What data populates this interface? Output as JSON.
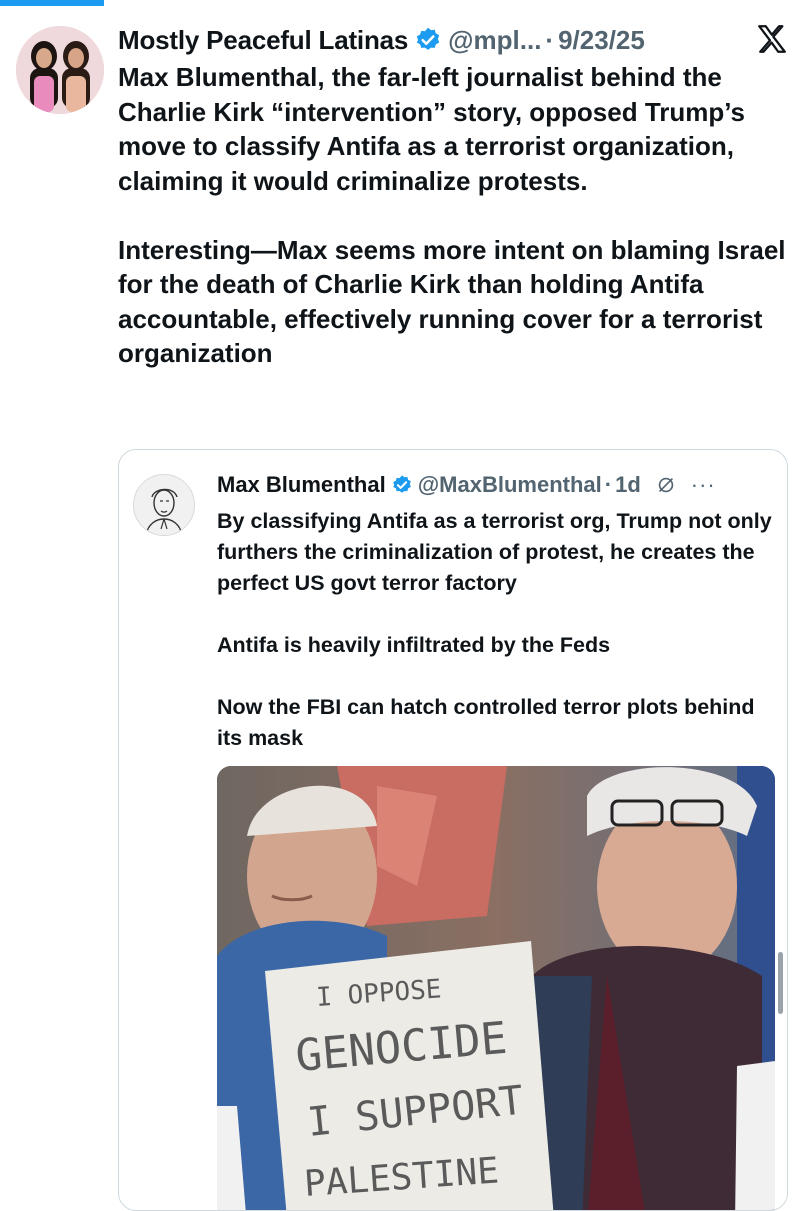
{
  "tweet": {
    "author_name": "Mostly Peaceful Latinas",
    "handle": "@mpl...",
    "separator": "·",
    "date": "9/23/25",
    "text": "Max Blumenthal, the far-left journalist behind the Charlie Kirk “intervention” story, opposed Trump’s move to classify Antifa as a terrorist organization, claiming it would criminalize protests.\n\nInteresting—Max seems more intent on blaming Israel for the death of Charlie Kirk than holding Antifa accountable, effectively running cover for a terrorist organization",
    "icons": {
      "avatar": "profile-photo",
      "verified": "verified-badge-icon",
      "platform": "x-logo-icon"
    }
  },
  "quoted_tweet": {
    "author_name": "Max Blumenthal",
    "handle": "@MaxBlumenthal",
    "separator": "·",
    "time": "1d",
    "more": "···",
    "text": "By classifying Antifa as a terrorist org, Trump not only furthers the criminalization of protest, he creates the perfect US govt terror factory\n\nAntifa is heavily infiltrated by the Feds\n\nNow the FBI can hatch controlled terror plots behind its mask",
    "media": {
      "sign_lines": [
        "I  OPPOSE",
        "GENOCIDE",
        "I  SUPPORT",
        "PALESTINE"
      ]
    },
    "icons": {
      "avatar": "sketch-avatar",
      "verified": "verified-badge-icon",
      "grok": "grok-icon",
      "more": "more-icon"
    }
  },
  "colors": {
    "accent": "#1d9bf0",
    "text": "#0f1419",
    "secondary": "#536471",
    "border": "#cfd9de"
  }
}
